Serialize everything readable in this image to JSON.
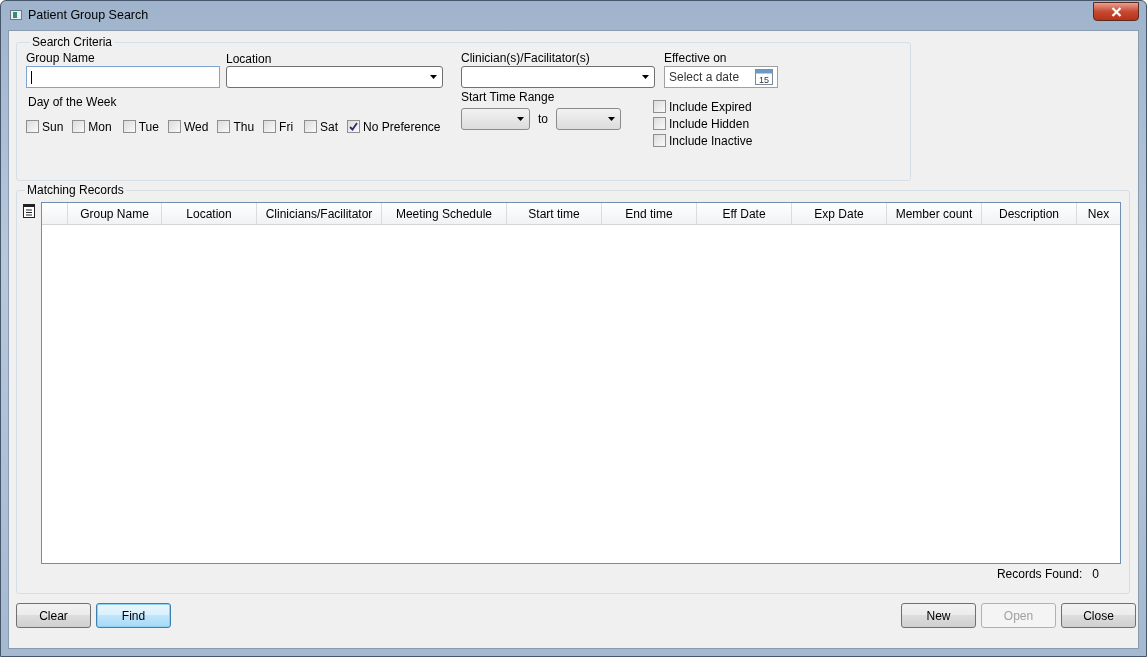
{
  "window": {
    "title": "Patient Group Search"
  },
  "search_criteria": {
    "title": "Search Criteria",
    "group_name": {
      "label": "Group Name"
    },
    "location": {
      "label": "Location"
    },
    "clinicians": {
      "label": "Clinician(s)/Facilitator(s)"
    },
    "effective_on": {
      "label": "Effective on",
      "placeholder": "Select a date",
      "calendar_day": "15"
    },
    "day_of_week": {
      "label": "Day of the Week",
      "days": [
        {
          "label": "Sun",
          "checked": false
        },
        {
          "label": "Mon",
          "checked": false
        },
        {
          "label": "Tue",
          "checked": false
        },
        {
          "label": "Wed",
          "checked": false
        },
        {
          "label": "Thu",
          "checked": false
        },
        {
          "label": "Fri",
          "checked": false
        },
        {
          "label": "Sat",
          "checked": false
        },
        {
          "label": "No Preference",
          "checked": true
        }
      ]
    },
    "start_time_range": {
      "label": "Start Time Range",
      "separator": "to"
    },
    "options": [
      {
        "label": "Include Expired",
        "checked": false
      },
      {
        "label": "Include Hidden",
        "checked": false
      },
      {
        "label": "Include Inactive",
        "checked": false
      }
    ]
  },
  "matching_records": {
    "title": "Matching Records",
    "columns": [
      "Group Name",
      "Location",
      "Clinicians/Facilitator",
      "Meeting Schedule",
      "Start time",
      "End time",
      "Eff Date",
      "Exp Date",
      "Member count",
      "Description",
      "Nex"
    ],
    "records_found": {
      "label": "Records Found:",
      "value": "0"
    }
  },
  "buttons_left": [
    {
      "label": "Clear",
      "disabled": false,
      "focused": false
    },
    {
      "label": "Find",
      "disabled": false,
      "focused": true
    }
  ],
  "buttons_right": [
    {
      "label": "New",
      "disabled": false,
      "focused": false
    },
    {
      "label": "Open",
      "disabled": true,
      "focused": false
    },
    {
      "label": "Close",
      "disabled": false,
      "focused": false
    }
  ]
}
